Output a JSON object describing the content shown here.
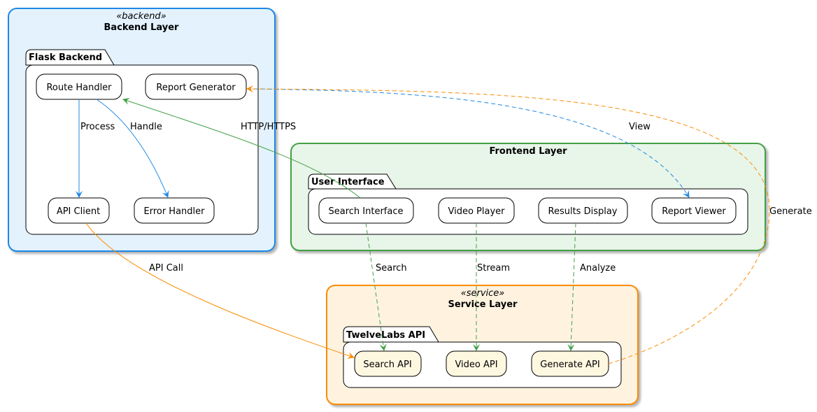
{
  "colors": {
    "backend": "#1E88E5",
    "backend_fill": "#E3F2FD",
    "frontend": "#43A047",
    "frontend_fill": "#E8F5E9",
    "service": "#FB8C00",
    "service_fill": "#FFF3E0",
    "service_node_fill": "#FFF8E1"
  },
  "backend": {
    "stereotype": "«backend»",
    "title": "Backend Layer",
    "package": "Flask Backend",
    "nodes": [
      "Route Handler",
      "Report Generator",
      "API Client",
      "Error Handler"
    ]
  },
  "frontend": {
    "title": "Frontend Layer",
    "package": "User Interface",
    "nodes": [
      "Search Interface",
      "Video Player",
      "Results Display",
      "Report Viewer"
    ]
  },
  "service": {
    "stereotype": "«service»",
    "title": "Service Layer",
    "package": "TwelveLabs API",
    "nodes": [
      "Search API",
      "Video API",
      "Generate API"
    ]
  },
  "edges": [
    {
      "from": "Route Handler",
      "to": "API Client",
      "label": "Process",
      "style": "solid",
      "color": "#1E88E5"
    },
    {
      "from": "Route Handler",
      "to": "Error Handler",
      "label": "Handle",
      "style": "solid",
      "color": "#1E88E5"
    },
    {
      "from": "Search Interface",
      "to": "Route Handler",
      "label": "HTTP/HTTPS",
      "style": "solid",
      "color": "#43A047"
    },
    {
      "from": "Report Generator",
      "to": "Report Viewer",
      "label": "View",
      "style": "dashed",
      "color": "#1E88E5"
    },
    {
      "from": "Generate API",
      "to": "Report Generator",
      "label": "Generate",
      "style": "dashed",
      "color": "#FB8C00"
    },
    {
      "from": "API Client",
      "to": "Search API",
      "label": "API Call",
      "style": "solid",
      "color": "#FB8C00"
    },
    {
      "from": "Search Interface",
      "to": "Search API",
      "label": "Search",
      "style": "dashed",
      "color": "#43A047"
    },
    {
      "from": "Video Player",
      "to": "Video API",
      "label": "Stream",
      "style": "dashed",
      "color": "#43A047"
    },
    {
      "from": "Results Display",
      "to": "Generate API",
      "label": "Analyze",
      "style": "dashed",
      "color": "#43A047"
    }
  ]
}
